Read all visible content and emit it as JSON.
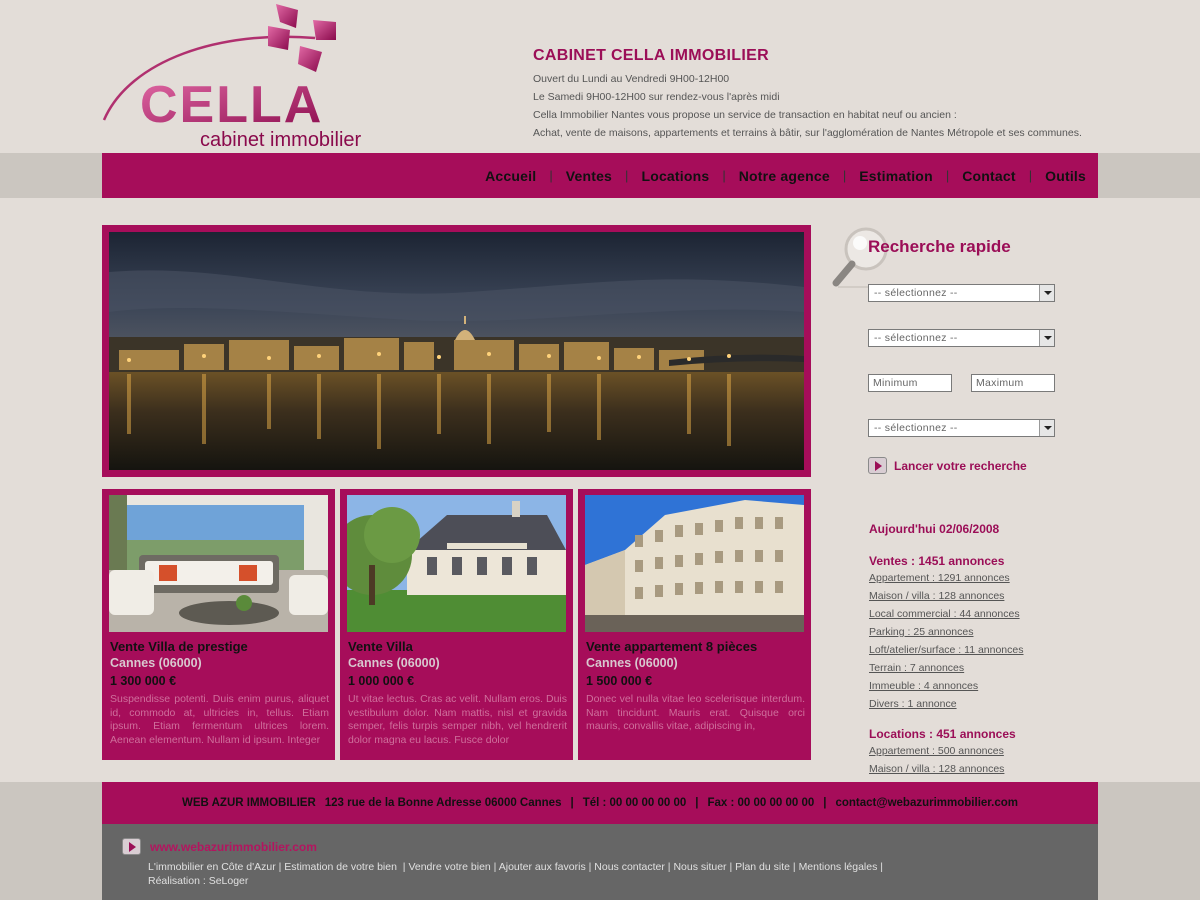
{
  "logo": {
    "brand": "CELLA",
    "tagline": "cabinet immobilier"
  },
  "header": {
    "title": "CABINET CELLA IMMOBILIER",
    "lines": [
      "Ouvert du Lundi au Vendredi 9H00-12H00",
      "Le Samedi 9H00-12H00 sur rendez-vous l'après midi",
      "Cella Immobilier Nantes vous propose un service de transaction en habitat neuf ou ancien :",
      "Achat, vente de maisons, appartements et terrains à bâtir, sur l'agglomération de Nantes Métropole et ses communes."
    ]
  },
  "nav": {
    "items": [
      {
        "label": "Accueil"
      },
      {
        "label": "Ventes"
      },
      {
        "label": "Locations"
      },
      {
        "label": "Notre agence"
      },
      {
        "label": "Estimation"
      },
      {
        "label": "Contact"
      },
      {
        "label": "Outils"
      }
    ],
    "separator": "|"
  },
  "cards": [
    {
      "title": "Vente Villa de prestige",
      "city": "Cannes (06000)",
      "price": "1 300 000 €",
      "desc": "Suspendisse potenti. Duis enim purus, aliquet id, commodo at, ultricies in, tellus. Etiam ipsum. Etiam fermentum ultrices lorem. Aenean elementum. Nullam id ipsum. Integer"
    },
    {
      "title": "Vente Villa",
      "city": "Cannes (06000)",
      "price": "1 000 000 €",
      "desc": "Ut vitae lectus. Cras ac velit. Nullam eros. Duis vestibulum dolor. Nam mattis, nisl et gravida semper, felis turpis semper nibh, vel hendrerit dolor magna eu lacus. Fusce dolor"
    },
    {
      "title": "Vente appartement 8 pièces",
      "city": "Cannes (06000)",
      "price": "1 500 000 €",
      "desc": "Donec vel nulla vitae leo scelerisque interdum. Nam tincidunt. Mauris erat. Quisque orci mauris, convallis vitae, adipiscing in,"
    }
  ],
  "search": {
    "title": "Recherche rapide",
    "select1": "-- sélectionnez --",
    "select2": "-- sélectionnez --",
    "min_placeholder": "Minimum",
    "max_placeholder": "Maximum",
    "select3": "-- sélectionnez --",
    "button": "Lancer votre recherche"
  },
  "stats": {
    "date": "Aujourd'hui 02/06/2008",
    "ventes": {
      "title": "Ventes : 1451 annonces",
      "items": [
        "Appartement : 1291 annonces",
        "Maison / villa : 128 annonces",
        "Local commercial : 44 annonces",
        "Parking : 25 annonces",
        "Loft/atelier/surface : 11 annonces",
        "Terrain : 7 annonces",
        "Immeuble : 4 annonces",
        "Divers : 1 annonce"
      ]
    },
    "locations": {
      "title": "Locations : 451 annonces",
      "items": [
        "Appartement : 500 annonces",
        "Maison / villa : 128 annonces"
      ]
    }
  },
  "footer": {
    "company": "WEB AZUR IMMOBILIER",
    "address": "123 rue de la Bonne Adresse 06000 Cannes",
    "tel": "Tél : 00 00 00 00 00",
    "fax": "Fax : 00 00 00 00 00",
    "email": "contact@webazurimmobilier.com",
    "separator": "|",
    "website": "www.webazurimmobilier.com",
    "links": [
      "L'immobilier en Côte d'Azur",
      "Estimation de votre bien",
      "Vendre votre bien",
      "Ajouter aux favoris",
      "Nous contacter",
      "Nous situer",
      "Plan du site",
      "Mentions légales"
    ],
    "credit": "Réalisation : SeLoger"
  },
  "colors": {
    "brand": "#a60d5a",
    "brand_text": "#9b0e57",
    "background": "#e3ddd8",
    "footer_grey": "#666666"
  }
}
